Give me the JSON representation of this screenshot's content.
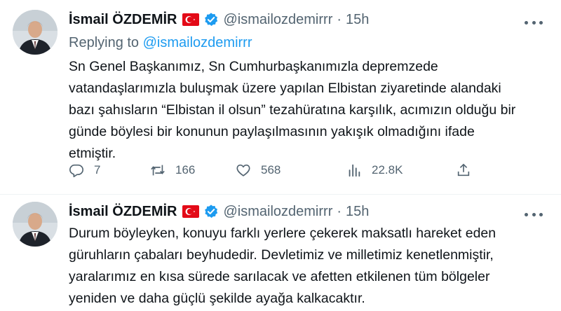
{
  "tweets": [
    {
      "author": {
        "name": "İsmail ÖZDEMİR",
        "handle": "@ismailozdemirrr",
        "time": "15h",
        "flag_icon": "turkey-flag-icon",
        "verified_icon": "verified-badge-icon"
      },
      "replying_to": {
        "prefix": "Replying to",
        "mention": "@ismailozdemirrr"
      },
      "text": "Sn Genel Başkanımız, Sn Cumhurbaşkanımızla depremzede\nvatandaşlarımızla buluşmak üzere yapılan Elbistan ziyaretinde alandaki\nbazı şahısların “Elbistan il olsun” tezahüratına karşılık, acımızın olduğu bir\ngünde böylesi bir konunun paylaşılmasının yakışık olmadığını ifade\netmiştir.",
      "actions": {
        "replies": "7",
        "retweets": "166",
        "likes": "568",
        "views": "22.8K"
      }
    },
    {
      "author": {
        "name": "İsmail ÖZDEMİR",
        "handle": "@ismailozdemirrr",
        "time": "15h",
        "flag_icon": "turkey-flag-icon",
        "verified_icon": "verified-badge-icon"
      },
      "text": "Durum böyleyken, konuyu farklı yerlere çekerek maksatlı hareket eden\ngüruhların çabaları beyhudedir. Devletimiz ve milletimiz kenetlenmiştir,\nyaralarımız en kısa sürede sarılacak ve afetten etkilenen tüm bölgeler\nyeniden ve daha güçlü şekilde ayağa kalkacaktır."
    }
  ],
  "colors": {
    "text": "#0f1419",
    "secondary": "#536471",
    "accent": "#1d9bf0",
    "flag_red": "#e30a17",
    "verified": "#1d9bf0"
  },
  "separator": "·"
}
